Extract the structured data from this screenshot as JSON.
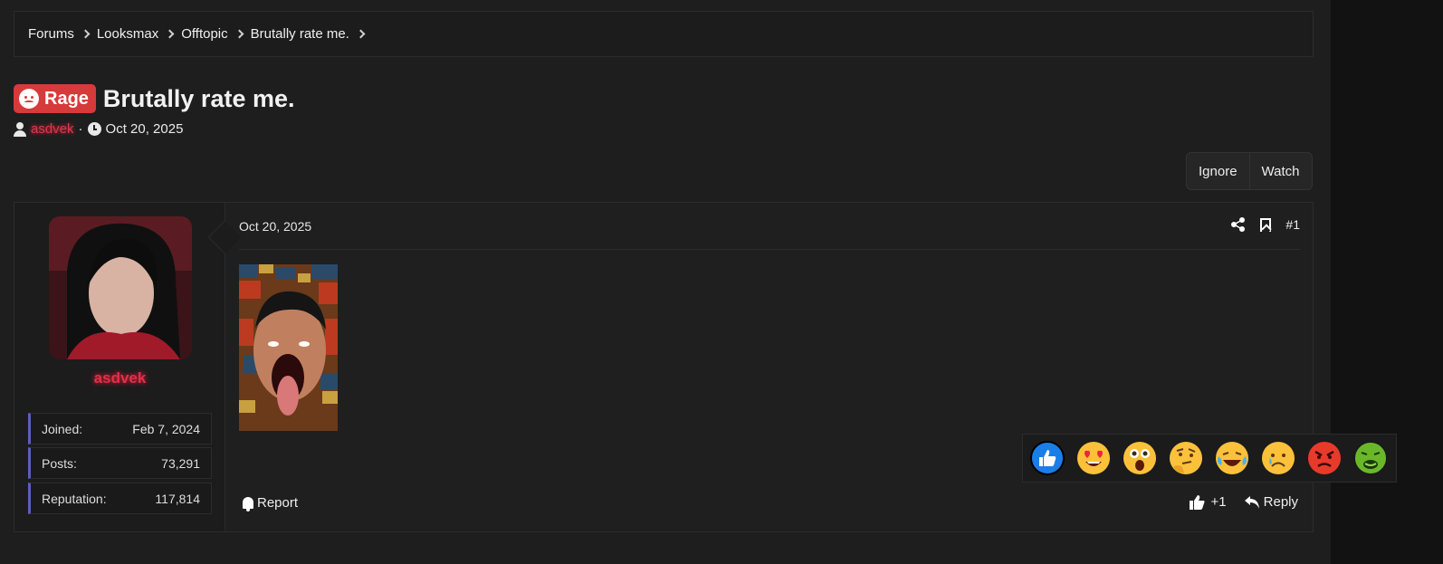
{
  "breadcrumb": [
    "Forums",
    "Looksmax",
    "Offtopic",
    "Brutally rate me."
  ],
  "thread": {
    "prefix": "Rage",
    "title": "Brutally rate me.",
    "author": "asdvek",
    "date": "Oct 20, 2025"
  },
  "buttons": {
    "ignore": "Ignore",
    "watch": "Watch"
  },
  "post": {
    "date": "Oct 20, 2025",
    "number": "#1",
    "report": "Report",
    "like_count": "+1",
    "reply": "Reply"
  },
  "user": {
    "name": "asdvek",
    "stats": [
      {
        "label": "Joined:",
        "value": "Feb 7, 2024"
      },
      {
        "label": "Posts:",
        "value": "73,291"
      },
      {
        "label": "Reputation:",
        "value": "117,814"
      }
    ]
  },
  "reactions": [
    "like-icon",
    "heart-eyes-icon",
    "shocked-icon",
    "thinking-icon",
    "laughing-crying-icon",
    "sad-icon",
    "angry-icon",
    "nauseated-icon"
  ],
  "colors": {
    "accent": "#5a5fc0",
    "prefix_bg": "#d63a3a",
    "username": "#e0304a",
    "background": "#1e1e1e"
  }
}
